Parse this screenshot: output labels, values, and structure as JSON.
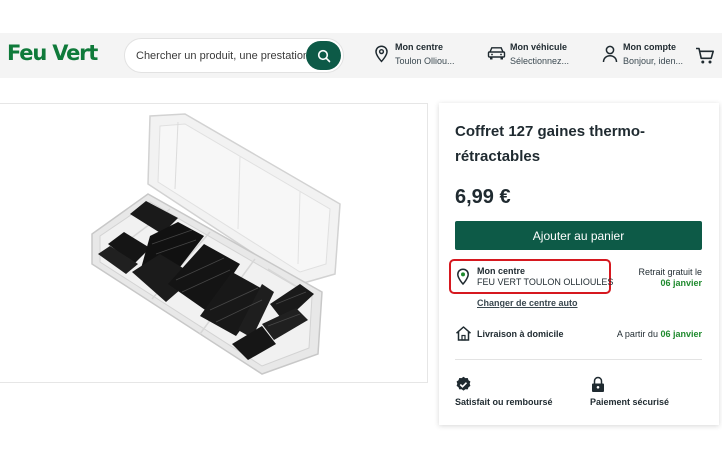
{
  "header": {
    "logo": "Feu Vert",
    "search": {
      "placeholder": "Chercher un produit, une prestation..."
    },
    "centre": {
      "label": "Mon centre",
      "value": "Toulon Olliou..."
    },
    "vehicle": {
      "label": "Mon véhicule",
      "value": "Sélectionnez..."
    },
    "account": {
      "label": "Mon compte",
      "value": "Bonjour, iden..."
    }
  },
  "product": {
    "title": "Coffret 127 gaines thermo-rétractables",
    "price": "6,99 €",
    "add_to_cart": "Ajouter au panier",
    "store": {
      "label": "Mon centre",
      "name": "FEU VERT TOULON OLLIOULES",
      "pickup_label": "Retrait gratuit le",
      "pickup_date": "06 janvier",
      "change_link": "Changer de centre auto"
    },
    "delivery": {
      "label": "Livraison à domicile",
      "from_label": "A partir du",
      "from_date": "06 janvier"
    },
    "badges": {
      "satisfied": "Satisfait ou remboursé",
      "secure": "Paiement sécurisé"
    }
  },
  "colors": {
    "brand_green": "#0f7a3a",
    "button_green": "#0d5a47",
    "date_green": "#1f8a2e",
    "highlight_red": "#d6181f"
  },
  "icons": [
    "search-icon",
    "location-pin-icon",
    "car-icon",
    "user-icon",
    "cart-icon",
    "home-icon",
    "satisfaction-badge-icon",
    "lock-icon"
  ]
}
